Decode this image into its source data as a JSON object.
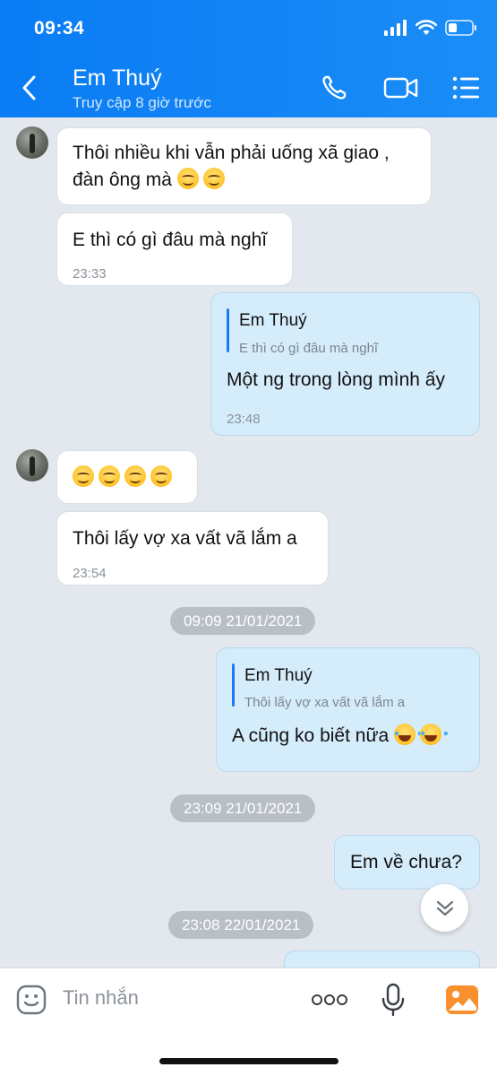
{
  "status_bar": {
    "time": "09:34"
  },
  "header": {
    "title": "Em Thuý",
    "subtitle": "Truy cập 8 giờ trước",
    "icons": [
      "back-icon",
      "phone-icon",
      "video-call-icon",
      "menu-icon"
    ]
  },
  "messages": [
    {
      "text_line1": "Thôi nhiều khi vẫn phải uống xã giao ,",
      "text_line2": "đàn ông mà",
      "emojis": [
        "smiling-face",
        "smiling-face"
      ]
    },
    {
      "text": "E thì có gì đâu mà nghĩ",
      "time": "23:33"
    },
    {
      "quote_name": "Em Thuý",
      "quote_text": "E thì có gì đâu mà nghĩ",
      "text": "Một ng trong lòng mình ấy",
      "time": "23:48"
    },
    {
      "emojis": [
        "smiling-face",
        "smiling-face",
        "smiling-face",
        "smiling-face"
      ]
    },
    {
      "text": "Thôi lấy vợ xa vất vã lắm a",
      "time": "23:54"
    },
    {
      "quote_name": "Em Thuý",
      "quote_text": "Thôi lấy vợ xa vất vã lắm a",
      "text": "A cũng ko biết nữa",
      "emojis": [
        "tears-of-joy",
        "tears-of-joy"
      ]
    },
    {
      "text": "Em về chưa?"
    }
  ],
  "date_separators": [
    "09:09 21/01/2021",
    "23:09 21/01/2021",
    "23:08 22/01/2021"
  ],
  "input": {
    "placeholder": "Tin nhắn"
  },
  "colors": {
    "header": "#0a7cf4",
    "out_bubble": "#d5ecfb",
    "in_bubble": "#ffffff",
    "background": "#e3e8ef",
    "accent": "#1a7cf5"
  }
}
